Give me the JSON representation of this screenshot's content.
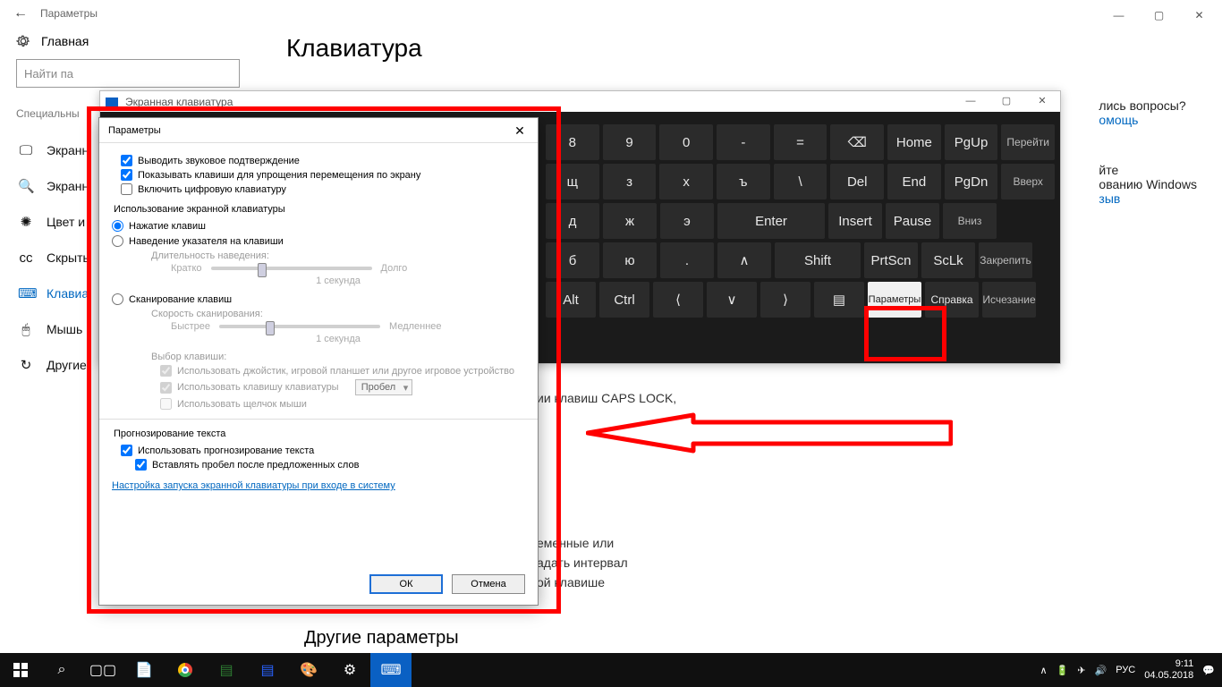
{
  "settings": {
    "back_icon": "←",
    "title": "Параметры",
    "wc": {
      "min": "—",
      "max": "▢",
      "close": "✕"
    },
    "home": "Главная",
    "search_placeholder": "Найти па",
    "group_title": "Специальны",
    "items": [
      {
        "label": "Экранн",
        "icon": "🖵"
      },
      {
        "label": "Экранн",
        "icon": "🔍"
      },
      {
        "label": "Цвет и",
        "icon": "✺"
      },
      {
        "label": "Скрыть",
        "icon": "cc"
      },
      {
        "label": "Клавиа",
        "icon": "⌨"
      },
      {
        "label": "Мышь",
        "icon": "🖱"
      },
      {
        "label": "Другие",
        "icon": "↻"
      }
    ],
    "heading": "Клавиатура",
    "frag_caps": "ии клавиш CAPS LOCK,",
    "frag_a": "еменные или",
    "frag_b": "адать интервал",
    "frag_c": "ой клавише",
    "other_h": "Другие параметры",
    "help_q": "лись вопросы?",
    "help_link": "омощь",
    "win_a": "йте",
    "win_b": "ованию Windows",
    "feedback": "зыв"
  },
  "osk": {
    "title": "Экранная клавиатура",
    "wc": {
      "min": "—",
      "max": "▢",
      "close": "✕"
    },
    "keys_row1": [
      "8",
      "9",
      "0",
      "-",
      "=",
      "⌫",
      "Home",
      "PgUp",
      "Перейти"
    ],
    "keys_row1_sup": [
      "*",
      "(",
      ")",
      "_",
      "+"
    ],
    "keys_row2": [
      "щ",
      "з",
      "х",
      "ъ",
      "\\",
      "Del",
      "End",
      "PgDn",
      "Вверх"
    ],
    "keys_row3": [
      "д",
      "ж",
      "э",
      "Enter",
      "Insert",
      "Pause",
      "Вниз"
    ],
    "keys_row4": [
      "б",
      "ю",
      ".",
      "∧",
      "Shift",
      "PrtScn",
      "ScLk",
      "Закрепить"
    ],
    "keys_row5": [
      "Alt",
      "Ctrl",
      "⟨",
      "∨",
      "⟩",
      "▤",
      "Параметры",
      "Справка",
      "Исчезание"
    ]
  },
  "params": {
    "title": "Параметры",
    "close": "✕",
    "chk_sound": "Выводить звуковое подтверждение",
    "chk_show": "Показывать клавиши для упрощения перемещения по экрану",
    "chk_numpad": "Включить цифровую клавиатуру",
    "usage_title": "Использование экранной клавиатуры",
    "radio_click": "Нажатие клавиш",
    "radio_hover": "Наведение указателя на клавиши",
    "hover_label": "Длительность наведения:",
    "short": "Кратко",
    "long": "Долго",
    "one_sec": "1 секунда",
    "radio_scan": "Сканирование клавиш",
    "scan_label": "Скорость сканирования:",
    "faster": "Быстрее",
    "slower": "Медленнее",
    "keysel_title": "Выбор клавиши:",
    "chk_joy": "Использовать джойстик, игровой планшет или другое игровое устройство",
    "chk_kbd": "Использовать клавишу клавиатуры",
    "combo_space": "Пробел",
    "chk_mouse": "Использовать щелчок мыши",
    "pred_title": "Прогнозирование текста",
    "chk_pred": "Использовать прогнозирование текста",
    "chk_space": "Вставлять пробел после предложенных слов",
    "link": "Настройка запуска экранной клавиатуры при входе в систему",
    "ok": "ОК",
    "cancel": "Отмена"
  },
  "taskbar": {
    "lang": "РУС",
    "time": "9:11",
    "date": "04.05.2018",
    "chevron": " ∧ "
  }
}
